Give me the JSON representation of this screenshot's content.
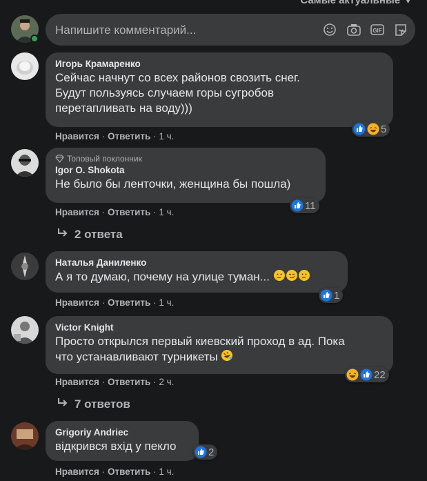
{
  "sort_label": "Самые актуальные",
  "composer": {
    "placeholder": "Напишите комментарий..."
  },
  "actions": {
    "like": "Нравится",
    "reply": "Ответить",
    "sep": "·"
  },
  "comments": [
    {
      "name": "Игорь Крамаренко",
      "lines": [
        "Сейчас начнут со всех районов свозить снег.",
        "Будут пользуясь случаем горы сугробов",
        "перетапливать на воду)))"
      ],
      "time": "1 ч.",
      "reaction_count": "5"
    },
    {
      "badge": "Топовый поклонник",
      "name": "Igor O. Shokota",
      "lines": [
        "Не было бы ленточки, женщина бы пошла)"
      ],
      "time": "1 ч.",
      "reaction_count": "11",
      "replies": "2 ответа"
    },
    {
      "name": "Наталья Даниленко",
      "lines": [
        "А я то думаю, почему на улице туман..."
      ],
      "time": "1 ч.",
      "reaction_count": "1"
    },
    {
      "name": "Victor Knight",
      "lines": [
        "Просто открылся первый киевский проход в ад. Пока",
        "что устанавливают турникеты"
      ],
      "time": "2 ч.",
      "reaction_count": "22",
      "replies": "7 ответов"
    },
    {
      "name": "Grigoriy Andriec",
      "lines": [
        "відкрився вхід у пекло"
      ],
      "time": "1 ч.",
      "reaction_count": "2"
    }
  ]
}
